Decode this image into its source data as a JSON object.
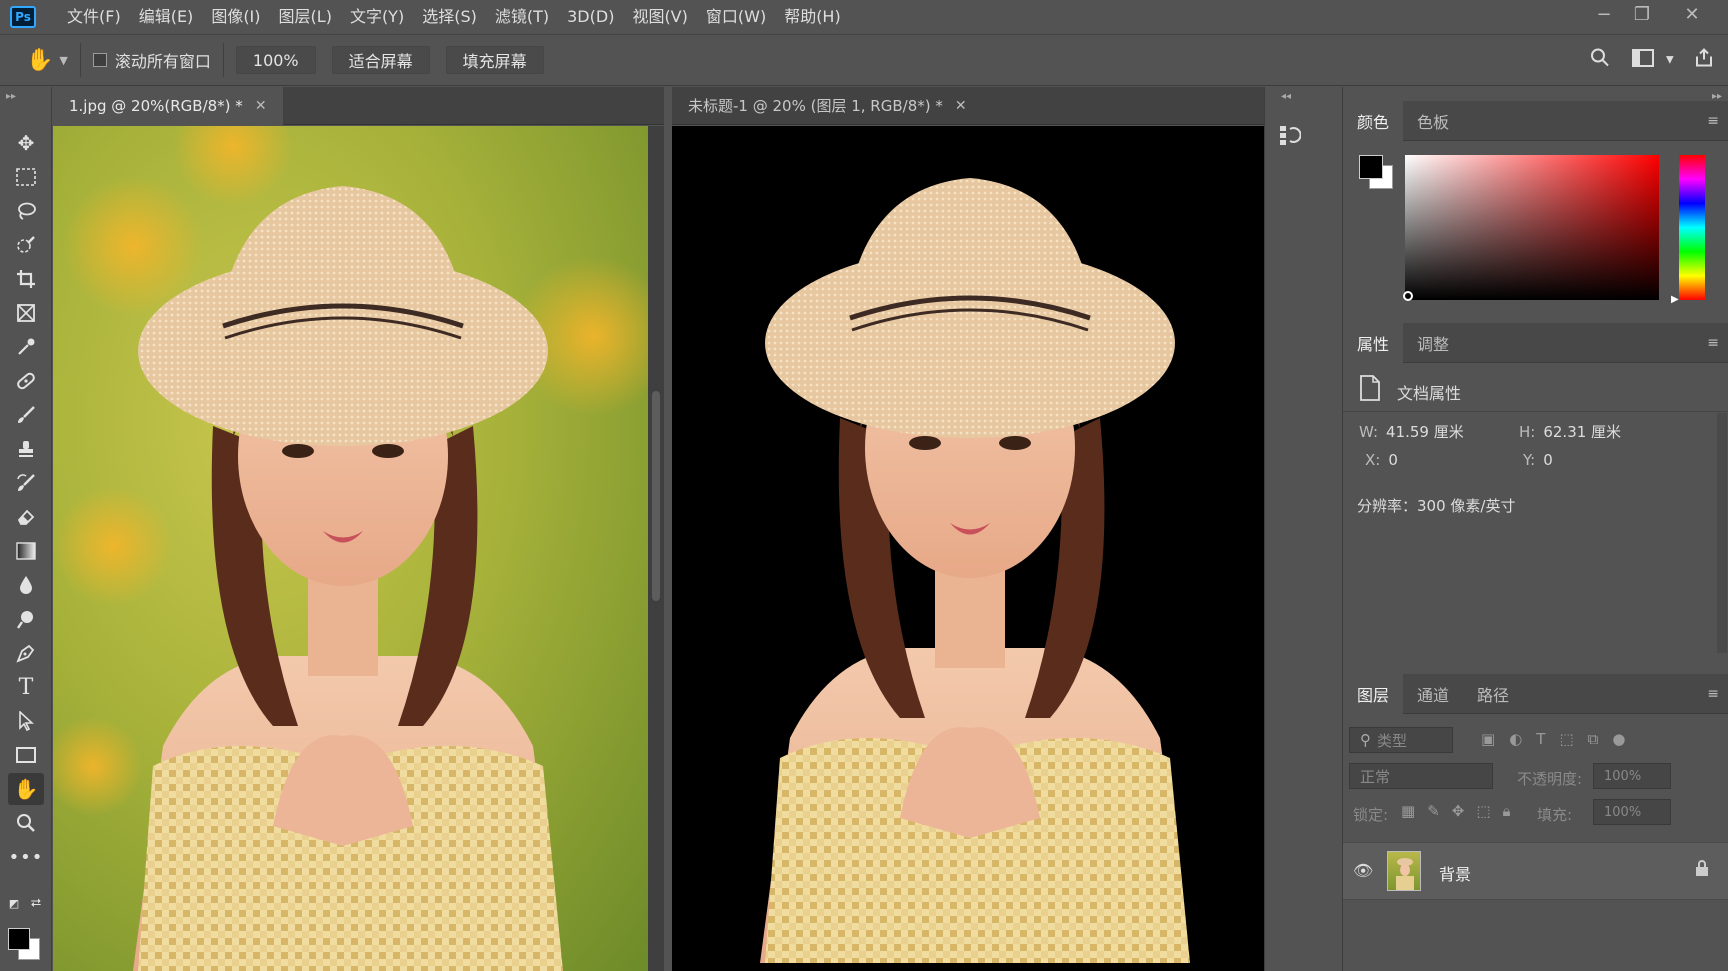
{
  "app": {
    "logo": "Ps"
  },
  "menu": [
    "文件(F)",
    "编辑(E)",
    "图像(I)",
    "图层(L)",
    "文字(Y)",
    "选择(S)",
    "滤镜(T)",
    "3D(D)",
    "视图(V)",
    "窗口(W)",
    "帮助(H)"
  ],
  "options": {
    "scroll_all": "滚动所有窗口",
    "zoom": "100%",
    "fit_screen": "适合屏幕",
    "fill_screen": "填充屏幕"
  },
  "documents": [
    {
      "title": "1.jpg @ 20%(RGB/8*) *"
    },
    {
      "title": "未标题-1 @ 20% (图层 1, RGB/8*) *"
    }
  ],
  "color_panel": {
    "tabs": [
      "颜色",
      "色板"
    ]
  },
  "properties_panel": {
    "tabs": [
      "属性",
      "调整"
    ],
    "doc_label": "文档属性",
    "w_label": "W:",
    "w_value": "41.59 厘米",
    "h_label": "H:",
    "h_value": "62.31 厘米",
    "x_label": "X:",
    "x_value": "0",
    "y_label": "Y:",
    "y_value": "0",
    "resolution": "分辨率：300 像素/英寸"
  },
  "layers_panel": {
    "tabs": [
      "图层",
      "通道",
      "路径"
    ],
    "filter_placeholder": "类型",
    "blend_mode": "正常",
    "opacity_label": "不透明度:",
    "opacity_value": "100%",
    "lock_label": "锁定:",
    "fill_label": "填充:",
    "fill_value": "100%",
    "layers": [
      {
        "name": "背景"
      }
    ]
  },
  "colors": {
    "accent": "#31a8ff",
    "foreground": "#000000",
    "background": "#ffffff"
  }
}
